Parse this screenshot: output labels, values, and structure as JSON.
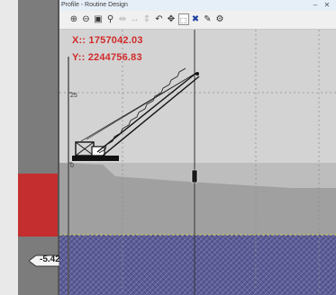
{
  "window": {
    "title": "Profile - Routine Design"
  },
  "toolbar": {
    "tools": [
      {
        "icon": "zoom-in-icon",
        "glyph": "⊕",
        "state": "enabled"
      },
      {
        "icon": "zoom-out-icon",
        "glyph": "⊖",
        "state": "enabled"
      },
      {
        "icon": "zoom-window-icon",
        "glyph": "▣",
        "state": "enabled"
      },
      {
        "icon": "magnify-icon",
        "glyph": "⚲",
        "state": "enabled"
      },
      {
        "icon": "pan-icon",
        "glyph": "⇹",
        "state": "disabled"
      },
      {
        "icon": "stretch-icon",
        "glyph": "↔",
        "state": "disabled"
      },
      {
        "icon": "fit-icon",
        "glyph": "⇕",
        "state": "disabled"
      },
      {
        "icon": "undo-icon",
        "glyph": "↶",
        "state": "enabled"
      },
      {
        "icon": "move-icon",
        "glyph": "✥",
        "state": "enabled"
      },
      {
        "icon": "select-icon",
        "glyph": "⬚",
        "state": "boxed"
      },
      {
        "icon": "crossed-tools-icon",
        "glyph": "✖",
        "state": "active"
      },
      {
        "icon": "edit-icon",
        "glyph": "✎",
        "state": "enabled"
      },
      {
        "icon": "settings-icon",
        "glyph": "⚙",
        "state": "enabled"
      }
    ]
  },
  "coordinates": {
    "x_label": "X:: 1757042.03",
    "y_label": "Y:: 2244756.83"
  },
  "axis": {
    "tick_upper": "25",
    "tick_lower": "0"
  },
  "depth_marker": {
    "value": "-5.42"
  },
  "colors": {
    "coord_text": "#d12a2a",
    "water": "#a6a6a6",
    "seabed_fill": "#5b5b94",
    "crane": "#111111",
    "left_red": "#c42e2e"
  }
}
